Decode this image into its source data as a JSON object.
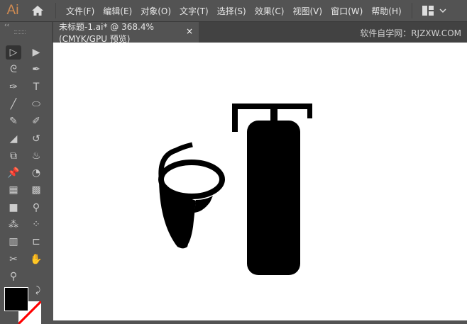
{
  "app": {
    "logo": "Ai"
  },
  "menu": [
    "文件(F)",
    "编辑(E)",
    "对象(O)",
    "文字(T)",
    "选择(S)",
    "效果(C)",
    "视图(V)",
    "窗口(W)",
    "帮助(H)"
  ],
  "tab": {
    "title": "未标题-1.ai* @ 368.4% (CMYK/GPU 预览)",
    "close": "×"
  },
  "watermark": "软件自学网：RJZXW.COM",
  "toolbar": {
    "collapse": "‹‹",
    "tools": [
      "selection-tool",
      "direct-selection-tool",
      "lasso-tool",
      "pen-tool",
      "curvature-tool",
      "type-tool",
      "line-tool",
      "ellipse-tool",
      "paintbrush-tool",
      "shaper-tool",
      "eraser-tool",
      "rotate-tool",
      "scale-tool",
      "warp-tool",
      "pin-tool",
      "shape-builder-tool",
      "perspective-grid-tool",
      "mesh-tool",
      "gradient-tool",
      "eyedropper-tool",
      "blend-tool",
      "symbol-sprayer-tool",
      "column-graph-tool",
      "artboard-tool",
      "slice-tool",
      "hand-tool",
      "zoom-tool"
    ],
    "glyphs": [
      "▷",
      "▶",
      "ᘓ",
      "✒",
      "✑",
      "T",
      "╱",
      "⬭",
      "✎",
      "✐",
      "◢",
      "↺",
      "⧉",
      "♨",
      "📌",
      "◔",
      "▦",
      "▩",
      "■",
      "⚲",
      "⁂",
      "⁘",
      "▥",
      "⊏",
      "✂",
      "✋",
      "⚲"
    ]
  },
  "colors": {
    "fill": "#000000",
    "stroke": "none",
    "accent": "#d08b52"
  }
}
